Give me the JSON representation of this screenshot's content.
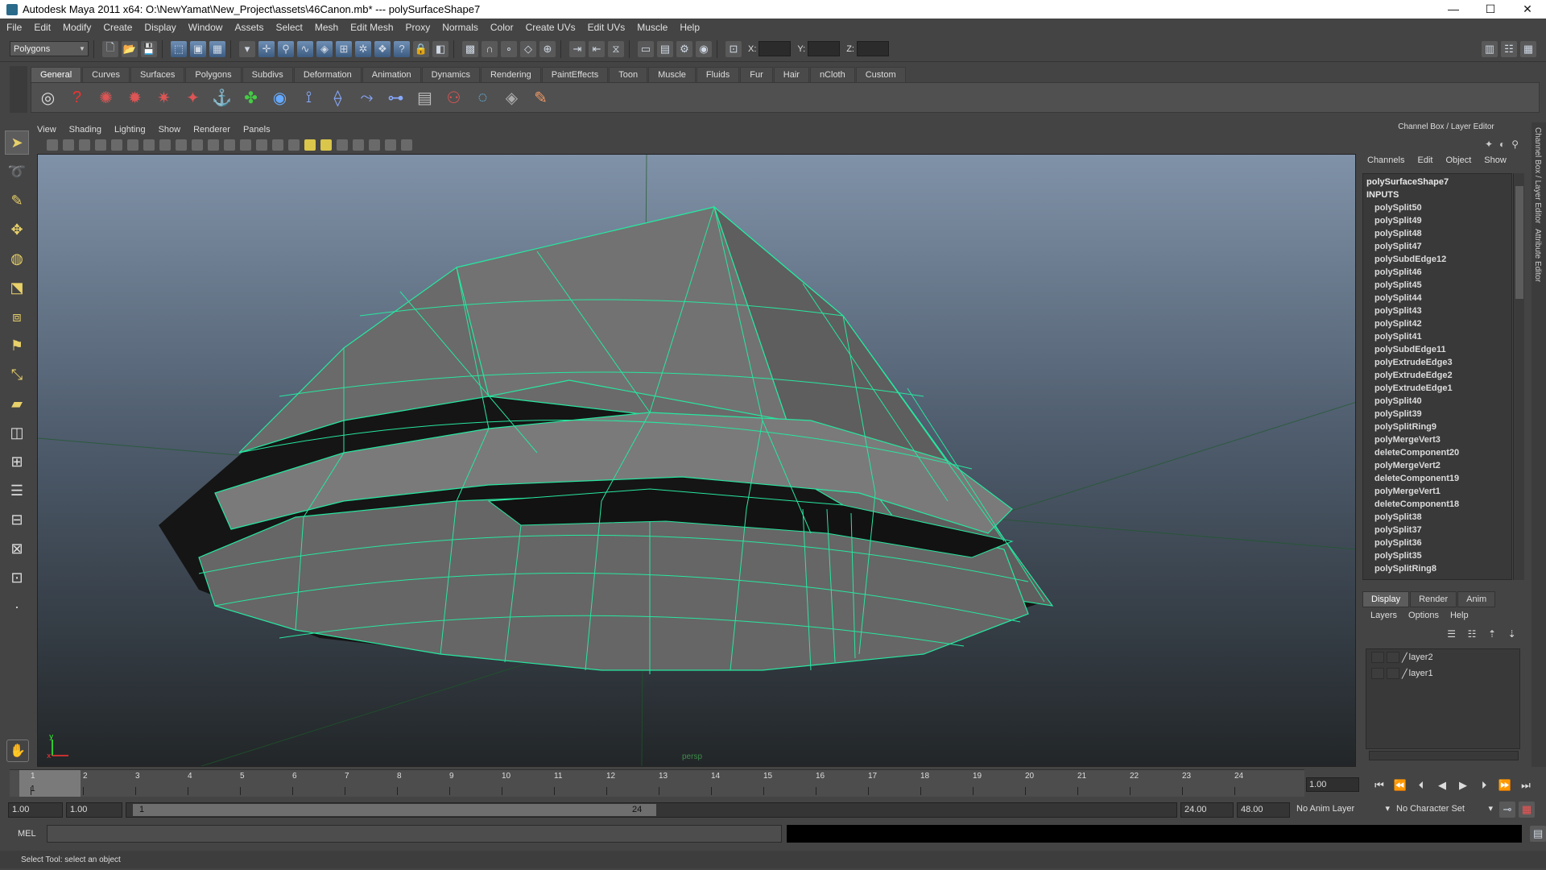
{
  "window": {
    "title": "Autodesk Maya 2011 x64: O:\\NewYamat\\New_Project\\assets\\46Canon.mb*   ---   polySurfaceShape7",
    "controls": [
      "—",
      "☐",
      "✕"
    ]
  },
  "menubar": [
    "File",
    "Edit",
    "Modify",
    "Create",
    "Display",
    "Window",
    "Assets",
    "Select",
    "Mesh",
    "Edit Mesh",
    "Proxy",
    "Normals",
    "Color",
    "Create UVs",
    "Edit UVs",
    "Muscle",
    "Help"
  ],
  "statusline": {
    "menu_set": "Polygons",
    "coord_labels": [
      "X:",
      "Y:",
      "Z:"
    ]
  },
  "shelf": {
    "tabs": [
      "General",
      "Curves",
      "Surfaces",
      "Polygons",
      "Subdivs",
      "Deformation",
      "Animation",
      "Dynamics",
      "Rendering",
      "PaintEffects",
      "Toon",
      "Muscle",
      "Fluids",
      "Fur",
      "Hair",
      "nCloth",
      "Custom"
    ],
    "active_tab": "General",
    "icons": [
      "sphere-render-icon",
      "help-icon",
      "render-icon",
      "ipr-icon",
      "render-settings-icon",
      "hypershade-icon",
      "magnet-icon",
      "light-icon",
      "cube-icon",
      "joint-icon",
      "ik-icon",
      "ik-spline-icon",
      "skin-icon",
      "graph-icon",
      "character-icon",
      "nurbs-icon",
      "render-view-icon",
      "paint-icon"
    ]
  },
  "viewport": {
    "menus": [
      "View",
      "Shading",
      "Lighting",
      "Show",
      "Renderer",
      "Panels"
    ],
    "camera_label": "persp"
  },
  "channel_box": {
    "title": "Channel Box / Layer Editor",
    "menus": [
      "Channels",
      "Edit",
      "Object",
      "Show"
    ],
    "object_name": "polySurfaceShape7",
    "inputs_label": "INPUTS",
    "nodes": [
      "polySplit50",
      "polySplit49",
      "polySplit48",
      "polySplit47",
      "polySubdEdge12",
      "polySplit46",
      "polySplit45",
      "polySplit44",
      "polySplit43",
      "polySplit42",
      "polySplit41",
      "polySubdEdge11",
      "polyExtrudeEdge3",
      "polyExtrudeEdge2",
      "polyExtrudeEdge1",
      "polySplit40",
      "polySplit39",
      "polySplitRing9",
      "polyMergeVert3",
      "deleteComponent20",
      "polyMergeVert2",
      "deleteComponent19",
      "polyMergeVert1",
      "deleteComponent18",
      "polySplit38",
      "polySplit37",
      "polySplit36",
      "polySplit35",
      "polySplitRing8"
    ]
  },
  "right_tabs": [
    "Channel Box / Layer Editor",
    "Attribute Editor"
  ],
  "layer_editor": {
    "tabs": [
      "Display",
      "Render",
      "Anim"
    ],
    "active_tab": "Display",
    "menus": [
      "Layers",
      "Options",
      "Help"
    ],
    "layers": [
      "layer2",
      "layer1"
    ]
  },
  "timeline": {
    "ticks": [
      "1",
      "2",
      "3",
      "4",
      "5",
      "6",
      "7",
      "8",
      "9",
      "10",
      "11",
      "12",
      "13",
      "14",
      "15",
      "16",
      "17",
      "18",
      "19",
      "20",
      "21",
      "22",
      "23",
      "24"
    ],
    "current_marker": "1",
    "current_frame": "1.00",
    "playback_buttons": [
      "⏮",
      "⏪",
      "⏴",
      "◀",
      "▶",
      "⏵",
      "⏩",
      "⏭"
    ]
  },
  "range": {
    "start": "1.00",
    "anim_start": "1.00",
    "slider_start": "1",
    "slider_end": "24",
    "end": "24.00",
    "anim_end": "48.00",
    "anim_layer": "No Anim Layer",
    "character_set": "No Character Set"
  },
  "command_line": {
    "label": "MEL"
  },
  "help_line": {
    "text": "Select Tool: select an object"
  }
}
